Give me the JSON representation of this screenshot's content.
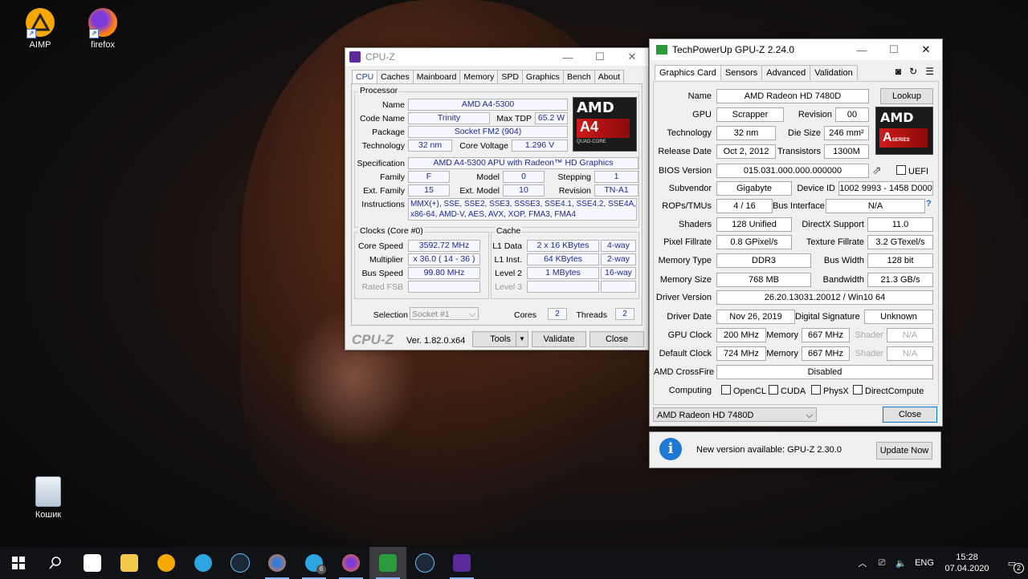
{
  "desktop": {
    "icons": [
      {
        "label": "AIMP"
      },
      {
        "label": "firefox"
      },
      {
        "label": "Кошик"
      }
    ]
  },
  "cpuz": {
    "title": "CPU-Z",
    "tabs": [
      "CPU",
      "Caches",
      "Mainboard",
      "Memory",
      "SPD",
      "Graphics",
      "Bench",
      "About"
    ],
    "processor_group": "Processor",
    "name_label": "Name",
    "name": "AMD A4-5300",
    "codename_label": "Code Name",
    "codename": "Trinity",
    "maxtdp_label": "Max TDP",
    "maxtdp": "65.2 W",
    "package_label": "Package",
    "package": "Socket FM2 (904)",
    "technology_label": "Technology",
    "technology": "32 nm",
    "corevoltage_label": "Core Voltage",
    "corevoltage": "1.296 V",
    "spec_label": "Specification",
    "spec": "AMD A4-5300 APU with Radeon™ HD Graphics",
    "family_label": "Family",
    "family": "F",
    "model_label": "Model",
    "model": "0",
    "stepping_label": "Stepping",
    "stepping": "1",
    "extfamily_label": "Ext. Family",
    "extfamily": "15",
    "extmodel_label": "Ext. Model",
    "extmodel": "10",
    "revision_label": "Revision",
    "revision": "TN-A1",
    "instructions_label": "Instructions",
    "instructions_line1": "MMX(+), SSE, SSE2, SSE3, SSSE3, SSE4.1, SSE4.2, SSE4A,",
    "instructions_line2": "x86-64, AMD-V, AES, AVX, XOP, FMA3, FMA4",
    "logo": {
      "brand": "AMD",
      "model": "A4",
      "sub": "QUAD-CORE"
    },
    "clocks_group": "Clocks (Core #0)",
    "corespeed_label": "Core Speed",
    "corespeed": "3592.72 MHz",
    "multiplier_label": "Multiplier",
    "multiplier": "x 36.0 ( 14 - 36 )",
    "busspeed_label": "Bus Speed",
    "busspeed": "99.80 MHz",
    "ratedfsb_label": "Rated FSB",
    "cache_group": "Cache",
    "l1data_label": "L1 Data",
    "l1data": "2 x 16 KBytes",
    "l1data_way": "4-way",
    "l1inst_label": "L1 Inst.",
    "l1inst": "64 KBytes",
    "l1inst_way": "2-way",
    "level2_label": "Level 2",
    "level2": "1 MBytes",
    "level2_way": "16-way",
    "level3_label": "Level 3",
    "selection_label": "Selection",
    "selection": "Socket #1",
    "cores_label": "Cores",
    "cores": "2",
    "threads_label": "Threads",
    "threads": "2",
    "brand": "CPU-Z",
    "version": "Ver. 1.82.0.x64",
    "tools_button": "Tools",
    "validate_button": "Validate",
    "close_button": "Close"
  },
  "gpuz": {
    "title": "TechPowerUp GPU-Z 2.24.0",
    "tabs": [
      "Graphics Card",
      "Sensors",
      "Advanced",
      "Validation"
    ],
    "name_label": "Name",
    "name": "AMD Radeon HD 7480D",
    "lookup_button": "Lookup",
    "gpu_label": "GPU",
    "gpu": "Scrapper",
    "revision_label": "Revision",
    "revision": "00",
    "technology_label": "Technology",
    "technology": "32 nm",
    "diesize_label": "Die Size",
    "diesize": "246 mm²",
    "releasedate_label": "Release Date",
    "releasedate": "Oct 2, 2012",
    "transistors_label": "Transistors",
    "transistors": "1300M",
    "bios_label": "BIOS Version",
    "bios": "015.031.000.000.000000",
    "uefi_label": "UEFI",
    "subvendor_label": "Subvendor",
    "subvendor": "Gigabyte",
    "deviceid_label": "Device ID",
    "deviceid": "1002 9993 - 1458 D000",
    "rops_label": "ROPs/TMUs",
    "rops": "4 / 16",
    "businterface_label": "Bus Interface",
    "businterface": "N/A",
    "shaders_label": "Shaders",
    "shaders": "128 Unified",
    "directx_label": "DirectX Support",
    "directx": "11.0",
    "pixelfill_label": "Pixel Fillrate",
    "pixelfill": "0.8 GPixel/s",
    "texturefill_label": "Texture Fillrate",
    "texturefill": "3.2 GTexel/s",
    "memtype_label": "Memory Type",
    "memtype": "DDR3",
    "buswidth_label": "Bus Width",
    "buswidth": "128 bit",
    "memsize_label": "Memory Size",
    "memsize": "768 MB",
    "bandwidth_label": "Bandwidth",
    "bandwidth": "21.3 GB/s",
    "driverver_label": "Driver Version",
    "driverver": "26.20.13031.20012 / Win10 64",
    "driverdate_label": "Driver Date",
    "driverdate": "Nov 26, 2019",
    "digsig_label": "Digital Signature",
    "digsig": "Unknown",
    "gpuclock_label": "GPU Clock",
    "gpuclock": "200 MHz",
    "memory_label": "Memory",
    "memclock": "667 MHz",
    "shader_label": "Shader",
    "shaderclock": "N/A",
    "defclock_label": "Default Clock",
    "defclock": "724 MHz",
    "defmemclock": "667 MHz",
    "defshaderclock": "N/A",
    "crossfire_label": "AMD CrossFire",
    "crossfire": "Disabled",
    "computing_label": "Computing",
    "computing": [
      "OpenCL",
      "CUDA",
      "PhysX",
      "DirectCompute"
    ],
    "logo": {
      "brand": "AMD",
      "model": "A",
      "sub": "SERIES"
    },
    "card_select": "AMD Radeon HD 7480D",
    "close_button": "Close"
  },
  "update": {
    "message": "New version available: GPU-Z 2.30.0",
    "button": "Update Now"
  },
  "taskbar": {
    "language": "ENG",
    "time": "15:28",
    "date": "07.04.2020",
    "telegram_badge": "6",
    "notif_badge": "2"
  }
}
